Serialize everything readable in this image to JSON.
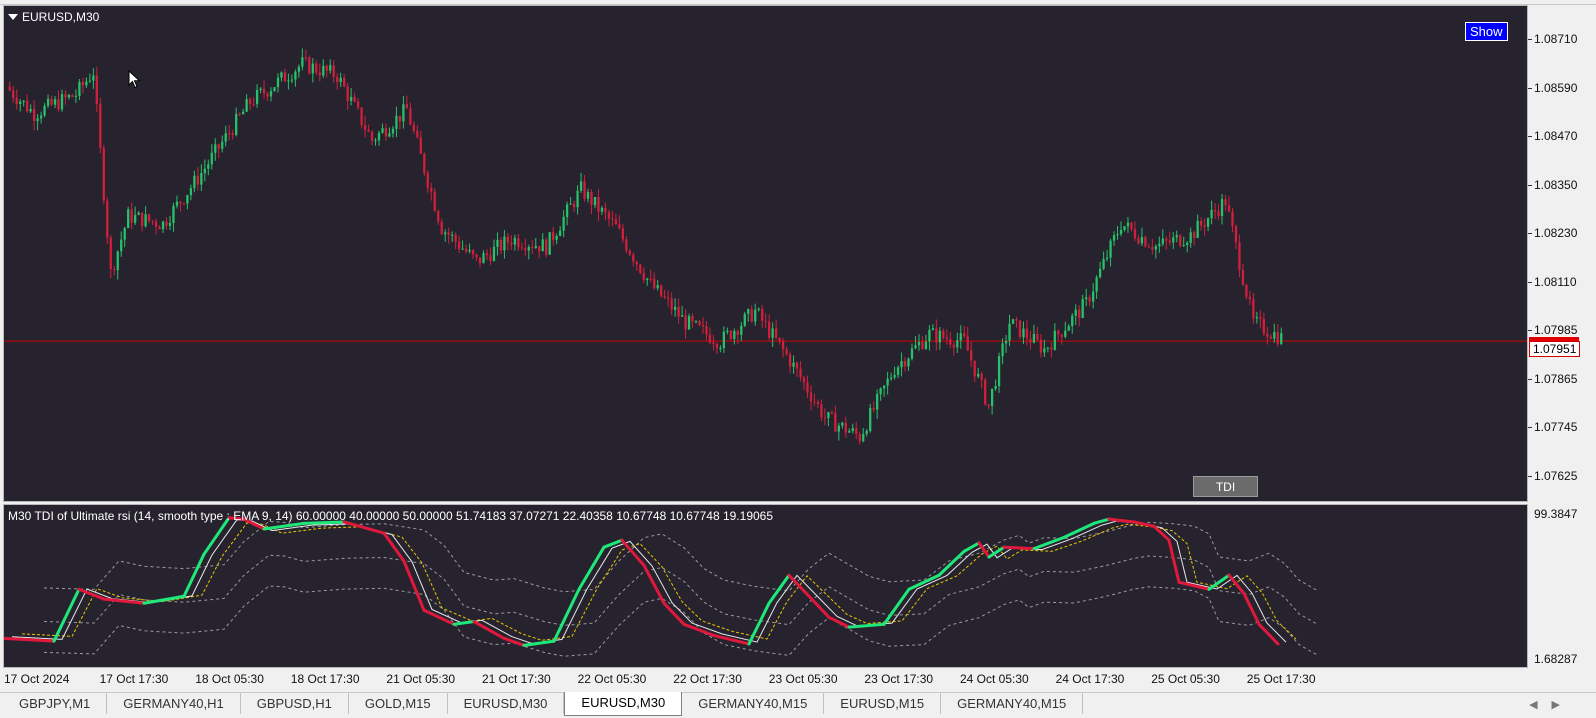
{
  "main_chart": {
    "symbol_label": "EURUSD,M30",
    "show_button": "Show",
    "tdi_button": "TDI",
    "current_price": "1.07951",
    "price_ticks": [
      "1.08710",
      "1.08590",
      "1.08470",
      "1.08350",
      "1.08230",
      "1.08110",
      "1.07985",
      "1.07865",
      "1.07745",
      "1.07625"
    ],
    "colors": {
      "background": "#27232e",
      "bull": "#26c26a",
      "bear": "#d11f3c",
      "price_line": "#d00000"
    }
  },
  "indicator": {
    "label": "M30 TDI of Ultimate rsi  (14, smooth type : EMA 9, 14) 60.00000 40.00000 50.00000 51.74183 37.07271 22.40358 10.67748 10.67748 19.19065",
    "top_value": "99.3847",
    "bottom_value": "1.68287",
    "colors": {
      "up": "#1ee87a",
      "down": "#e0183c",
      "signal": "#e6c800",
      "bands": "#9a9a9a",
      "rsi": "#e8e8e8"
    }
  },
  "time_axis": {
    "labels": [
      "17 Oct 2024",
      "17 Oct 17:30",
      "18 Oct 05:30",
      "18 Oct 17:30",
      "21 Oct 05:30",
      "21 Oct 17:30",
      "22 Oct 05:30",
      "22 Oct 17:30",
      "23 Oct 05:30",
      "23 Oct 17:30",
      "24 Oct 05:30",
      "24 Oct 17:30",
      "25 Oct 05:30",
      "25 Oct 17:30"
    ]
  },
  "tabs": [
    {
      "label": "GBPJPY,M1",
      "active": false
    },
    {
      "label": "GERMANY40,H1",
      "active": false
    },
    {
      "label": "GBPUSD,H1",
      "active": false
    },
    {
      "label": "GOLD,M15",
      "active": false
    },
    {
      "label": "EURUSD,M30",
      "active": false
    },
    {
      "label": "EURUSD,M30",
      "active": true
    },
    {
      "label": "GERMANY40,M15",
      "active": false
    },
    {
      "label": "EURUSD,M15",
      "active": false
    },
    {
      "label": "GERMANY40,M15",
      "active": false
    }
  ],
  "chart_data": {
    "type": "candlestick",
    "symbol": "EURUSD",
    "timeframe": "M30",
    "ylim": [
      1.0757,
      1.0878
    ],
    "current_price": 1.07951,
    "x_labels": [
      "17 Oct 2024",
      "17 Oct 17:30",
      "18 Oct 05:30",
      "18 Oct 17:30",
      "21 Oct 05:30",
      "21 Oct 17:30",
      "22 Oct 05:30",
      "22 Oct 17:30",
      "23 Oct 05:30",
      "23 Oct 17:30",
      "24 Oct 05:30",
      "24 Oct 17:30",
      "25 Oct 05:30",
      "25 Oct 17:30"
    ],
    "approx_close_path": [
      [
        0,
        1.0862
      ],
      [
        8,
        1.0855
      ],
      [
        20,
        1.086
      ],
      [
        25,
        1.0866
      ],
      [
        30,
        1.0813
      ],
      [
        35,
        1.0828
      ],
      [
        45,
        1.0826
      ],
      [
        55,
        1.0838
      ],
      [
        70,
        1.0858
      ],
      [
        85,
        1.0868
      ],
      [
        95,
        1.0865
      ],
      [
        105,
        1.0848
      ],
      [
        115,
        1.0856
      ],
      [
        125,
        1.0825
      ],
      [
        135,
        1.0816
      ],
      [
        145,
        1.0822
      ],
      [
        155,
        1.082
      ],
      [
        165,
        1.0835
      ],
      [
        175,
        1.0825
      ],
      [
        185,
        1.081
      ],
      [
        195,
        1.08
      ],
      [
        205,
        1.0795
      ],
      [
        215,
        1.0803
      ],
      [
        225,
        1.079
      ],
      [
        235,
        1.0775
      ],
      [
        245,
        1.077
      ],
      [
        255,
        1.0788
      ],
      [
        265,
        1.0797
      ],
      [
        275,
        1.0795
      ],
      [
        282,
        1.0778
      ],
      [
        288,
        1.08
      ],
      [
        298,
        1.0793
      ],
      [
        310,
        1.0805
      ],
      [
        320,
        1.0826
      ],
      [
        330,
        1.082
      ],
      [
        340,
        1.0823
      ],
      [
        350,
        1.0832
      ],
      [
        358,
        1.08
      ],
      [
        366,
        1.0796
      ]
    ],
    "indicator": {
      "name": "TDI of Ultimate rsi",
      "ylim": [
        1.68287,
        99.3847
      ],
      "levels": [
        60,
        40,
        50
      ]
    }
  }
}
